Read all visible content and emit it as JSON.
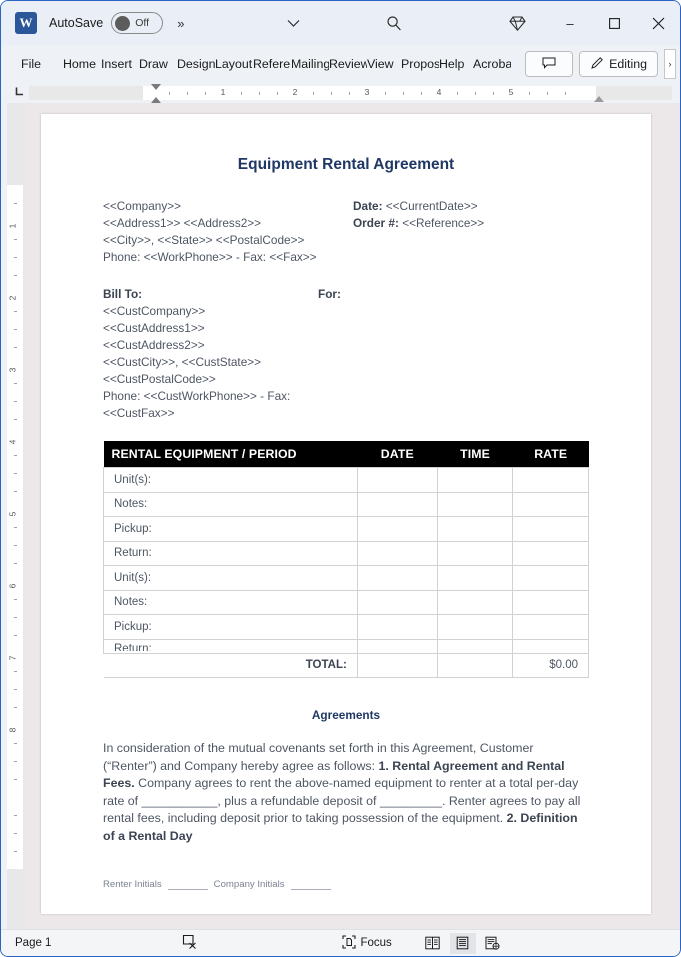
{
  "titlebar": {
    "app_logo": "word-logo",
    "logo_letter": "W",
    "autosave_label": "AutoSave",
    "autosave_state": "Off",
    "more_commands": "»",
    "customize_icon": "chevron-down-icon",
    "search_icon": "search-icon",
    "copilot_icon": "diamond-icon",
    "minimize": "–",
    "maximize": "☐",
    "close": "✕"
  },
  "ribbon": {
    "tabs": [
      {
        "label": "File"
      },
      {
        "label": "Home"
      },
      {
        "label": "Insert"
      },
      {
        "label": "Draw"
      },
      {
        "label": "Design"
      },
      {
        "label": "Layout"
      },
      {
        "label": "References"
      },
      {
        "label": "Mailings"
      },
      {
        "label": "Review"
      },
      {
        "label": "View"
      },
      {
        "label": "Proposify"
      },
      {
        "label": "Help"
      },
      {
        "label": "Acrobat"
      }
    ],
    "comment_button": "comment-icon",
    "editing_label": "Editing",
    "editing_icon": "pencil-icon",
    "overflow_arrow": "›"
  },
  "ruler": {
    "horizontal_numbers": [
      "1",
      "2",
      "3",
      "4",
      "5"
    ],
    "vertical_numbers": [
      "1",
      "2",
      "3",
      "4",
      "5",
      "6",
      "7",
      "8"
    ],
    "tabstop_marker": "L"
  },
  "document": {
    "title": "Equipment Rental Agreement",
    "header_left": [
      "<<Company>>",
      "<<Address1>> <<Address2>>",
      "<<City>>, <<State>> <<PostalCode>>",
      "Phone: <<WorkPhone>> - Fax: <<Fax>>"
    ],
    "header_right": [
      {
        "label": "Date:",
        "value": "<<CurrentDate>>"
      },
      {
        "label": "Order #:",
        "value": "<<Reference>>"
      }
    ],
    "billto_label": "Bill To:",
    "for_label": "For:",
    "billto_lines": [
      "<<CustCompany>>",
      "<<CustAddress1>>",
      "<<CustAddress2>>",
      "<<CustCity>>, <<CustState>>",
      "<<CustPostalCode>>",
      "Phone: <<CustWorkPhone>>  - Fax:",
      "<<CustFax>>"
    ],
    "table": {
      "headers": [
        "RENTAL EQUIPMENT / PERIOD",
        "DATE",
        "TIME",
        "RATE"
      ],
      "rows": [
        "Unit(s):",
        "Notes:",
        "Pickup:",
        "Return:",
        "Unit(s):",
        "Notes:",
        "Pickup:",
        "Return:"
      ],
      "total_label": "TOTAL:",
      "total_value": "$0.00"
    },
    "agreements_heading": "Agreements",
    "agreements_part1": "In consideration of the mutual covenants set forth in this Agreement, Customer (“Renter”) and Company hereby agree as follows: ",
    "agreements_bold1": "1. Rental Agreement and Rental Fees.",
    "agreements_part2": " Company agrees to rent the above-named equipment to renter at a total per-day rate of ___________, plus a refundable deposit of _________. Renter agrees to pay all rental fees, including deposit prior to taking possession of the equipment. ",
    "agreements_bold2": "2. Definition of a Rental Day",
    "initials": {
      "renter_label": "Renter Initials",
      "company_label": "Company Initials"
    }
  },
  "statusbar": {
    "page_label": "Page 1",
    "spellcheck_icon": "proofing-errors-icon",
    "focus_label": "Focus",
    "focus_icon": "focus-mode-icon",
    "view_read_icon": "read-mode-icon",
    "view_print_icon": "print-layout-icon",
    "view_web_icon": "web-layout-icon"
  },
  "colors": {
    "accent_title": "#1f3864",
    "table_header_bg": "#000000",
    "window_border": "#2a63c4",
    "canvas_bg": "#ece8e9"
  }
}
